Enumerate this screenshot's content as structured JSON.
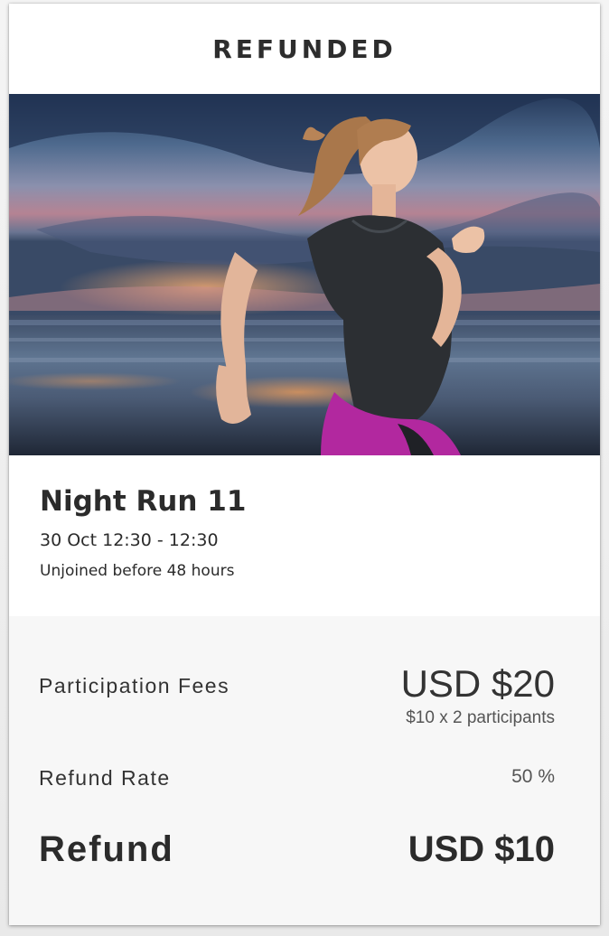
{
  "header": {
    "status_title": "REFUNDED"
  },
  "hero": {
    "image_subject": "woman running on beach at sunset"
  },
  "event": {
    "title": "Night Run 11",
    "datetime": "30 Oct 12:30 - 12:30",
    "note": "Unjoined before 48 hours"
  },
  "summary": {
    "participation_fees_label": "Participation Fees",
    "participation_fees_amount": "USD $20",
    "participation_fees_breakdown": "$10 x 2 participants",
    "refund_rate_label": "Refund Rate",
    "refund_rate_value": "50 %",
    "refund_label": "Refund",
    "refund_value": "USD $10"
  },
  "colors": {
    "text": "#2b2b2b",
    "summary_background": "#f7f7f7",
    "shorts_accent": "#b2289f"
  }
}
